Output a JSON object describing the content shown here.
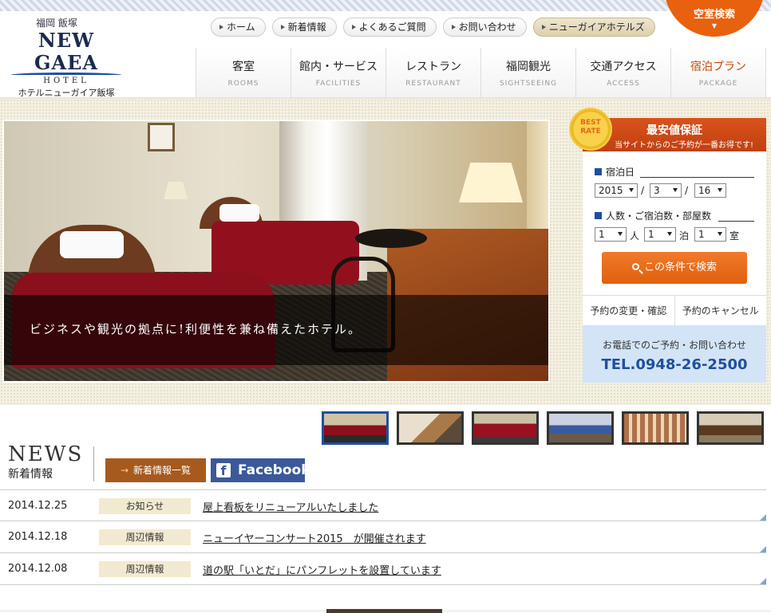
{
  "header": {
    "logo_city": "福岡 飯塚",
    "logo_name": "NEW GAEA",
    "logo_hotel": "HOTEL",
    "logo_jp": "ホテルニューガイア飯塚",
    "vacancy_label": "空室検索",
    "top_nav": [
      {
        "label": "ホーム"
      },
      {
        "label": "新着情報"
      },
      {
        "label": "よくあるご質問"
      },
      {
        "label": "お問い合わせ"
      },
      {
        "label": "ニューガイアホテルズ"
      }
    ],
    "main_nav": [
      {
        "jp": "客室",
        "en": "ROOMS"
      },
      {
        "jp": "館内・サービス",
        "en": "FACILITIES"
      },
      {
        "jp": "レストラン",
        "en": "RESTAURANT"
      },
      {
        "jp": "福岡観光",
        "en": "SIGHTSEEING"
      },
      {
        "jp": "交通アクセス",
        "en": "ACCESS"
      },
      {
        "jp": "宿泊プラン",
        "en": "PACKAGE"
      }
    ]
  },
  "hero": {
    "caption": "ビジネスや観光の拠点に!利便性を兼ね備えたホテル。",
    "slides_count": 6,
    "active_slide": 1
  },
  "booking": {
    "badge_line1": "BEST",
    "badge_line2": "RATE",
    "title": "最安値保証",
    "subtitle": "当サイトからのご予約が一番お得です!",
    "date_label": "宿泊日",
    "year": "2015",
    "month": "3",
    "day": "16",
    "slash": "/",
    "people_label": "人数・ご宿泊数・部屋数",
    "people": "1",
    "people_unit": "人",
    "nights": "1",
    "nights_unit": "泊",
    "rooms": "1",
    "rooms_unit": "室",
    "search_button": "この条件で検索",
    "change_link": "予約の変更・確認",
    "cancel_link": "予約のキャンセル",
    "tel_caption": "お電話でのご予約・お問い合わせ",
    "tel": "TEL.0948-26-2500"
  },
  "news": {
    "title_en": "NEWS",
    "title_jp": "新着情報",
    "list_button": "新着情報一覧",
    "list_button_arrow": "→",
    "facebook_label": "Facebook",
    "items": [
      {
        "date": "2014.12.25",
        "category": "お知らせ",
        "title": "屋上看板をリニューアルいたしました"
      },
      {
        "date": "2014.12.18",
        "category": "周辺情報",
        "title": "ニューイヤーコンサート2015　が開催されます"
      },
      {
        "date": "2014.12.08",
        "category": "周辺情報",
        "title": "道の駅「いとだ」にパンフレットを設置しています"
      }
    ]
  },
  "colors": {
    "accent_orange": "#e8610e",
    "navy": "#1b2a4e",
    "blue": "#1f4fa0",
    "facebook": "#3b5998",
    "news_button": "#a65a1e"
  }
}
